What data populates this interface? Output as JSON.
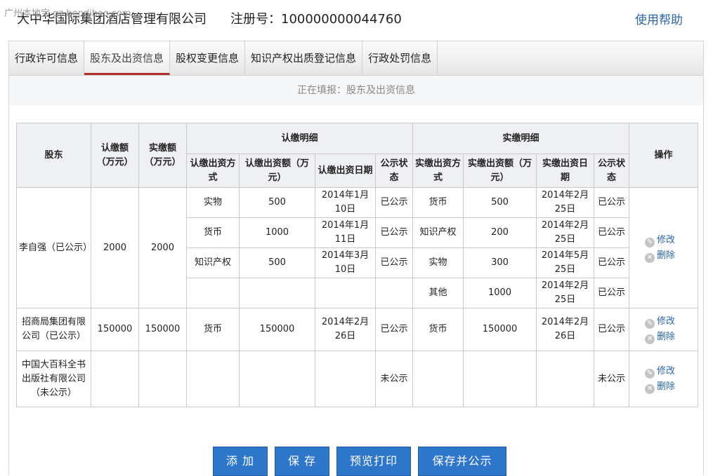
{
  "watermark": "广州本地宝 gz.bendibao.com",
  "header": {
    "company": "大中华国际集团酒店管理有限公司",
    "reg_label": "注册号：100000000044760",
    "help": "使用帮助"
  },
  "tabs": [
    "行政许可信息",
    "股东及出资信息",
    "股权变更信息",
    "知识产权出质登记信息",
    "行政处罚信息"
  ],
  "status_text": "正在填报：股东及出资信息",
  "table": {
    "h_shareholder": "股东",
    "h_sub_amount": "认缴额（万元）",
    "h_paid_amount": "实缴额（万元）",
    "h_sub_detail": "认缴明细",
    "h_paid_detail": "实缴明细",
    "h_op": "操作",
    "h_sub_method": "认缴出资方式",
    "h_sub_money": "认缴出资额（万元）",
    "h_sub_date": "认缴出资日期",
    "h_sub_status": "公示状态",
    "h_paid_method": "实缴出资方式",
    "h_paid_money": "实缴出资额（万元）",
    "h_paid_date": "实缴出资日期",
    "h_paid_status": "公示状态",
    "r1": {
      "name": "李自强（已公示）",
      "sub": "2000",
      "paid": "2000",
      "lines": [
        {
          "sm": "实物",
          "sa": "500",
          "sd": "2014年1月10日",
          "ss": "已公示",
          "pm": "货币",
          "pa": "500",
          "pd": "2014年2月25日",
          "ps": "已公示"
        },
        {
          "sm": "货币",
          "sa": "1000",
          "sd": "2014年1月11日",
          "ss": "已公示",
          "pm": "知识产权",
          "pa": "200",
          "pd": "2014年2月25日",
          "ps": "已公示"
        },
        {
          "sm": "知识产权",
          "sa": "500",
          "sd": "2014年3月10日",
          "ss": "已公示",
          "pm": "实物",
          "pa": "300",
          "pd": "2014年5月25日",
          "ps": "已公示"
        },
        {
          "sm": "",
          "sa": "",
          "sd": "",
          "ss": "",
          "pm": "其他",
          "pa": "1000",
          "pd": "2014年2月25日",
          "ps": "已公示"
        }
      ]
    },
    "r2": {
      "name": "招商局集团有限公司（已公示）",
      "sub": "150000",
      "paid": "150000",
      "sm": "货币",
      "sa": "150000",
      "sd": "2014年2月26日",
      "ss": "已公示",
      "pm": "货币",
      "pa": "150000",
      "pd": "2014年2月26日",
      "ps": "已公示"
    },
    "r3": {
      "name": "中国大百科全书出版社有限公司（未公示）",
      "ss": "未公示",
      "ps": "未公示"
    },
    "edit": "修改",
    "delete": "删除"
  },
  "buttons": {
    "add": "添 加",
    "save": "保 存",
    "preview": "预览打印",
    "save_publish": "保存并公示"
  }
}
